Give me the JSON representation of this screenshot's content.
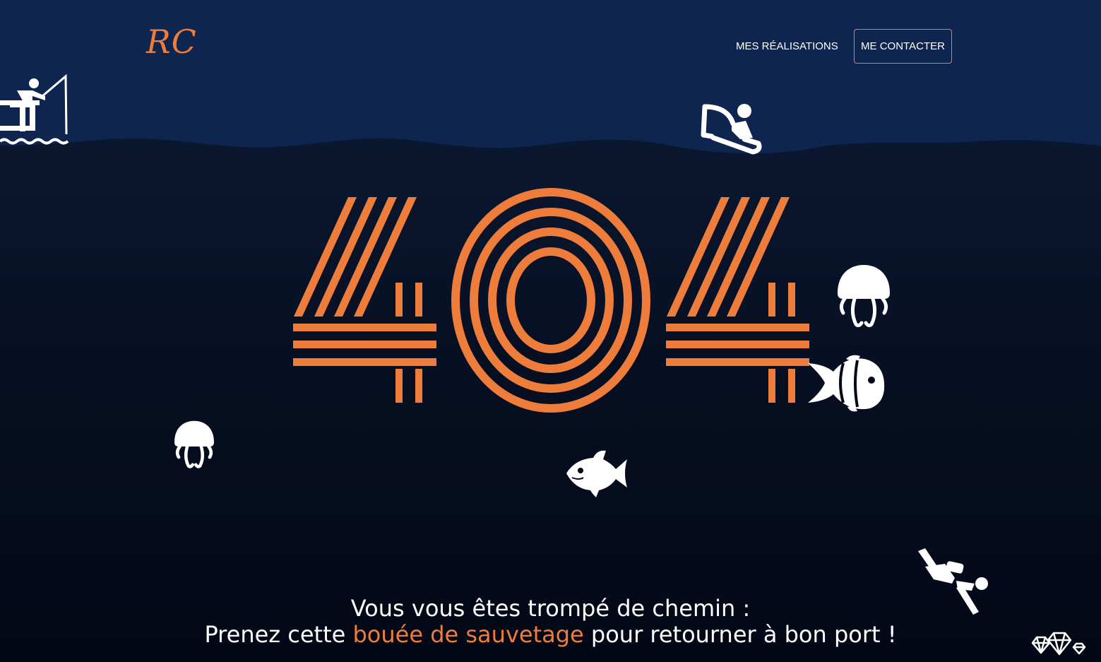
{
  "header": {
    "logo_text": "RC",
    "nav": {
      "realisations_label": "MES RÉALISATIONS",
      "contact_label": "ME CONTACTER"
    }
  },
  "main": {
    "error_code": "404",
    "message": {
      "line1": "Vous vous êtes trompé de chemin :",
      "line2_before": "Prenez cette ",
      "line2_link": "bouée de sauvetage",
      "line2_after": " pour retourner à bon port !"
    }
  },
  "icons": [
    "fisherman-icon",
    "boat-rider-icon",
    "jellyfish-icon",
    "clownfish-icon",
    "fish-icon",
    "diver-icon",
    "diamonds-icon"
  ],
  "colors": {
    "accent": "#ee7d3b",
    "sky": "#0e2550",
    "deep": "#030816",
    "icon": "#ffffff"
  }
}
